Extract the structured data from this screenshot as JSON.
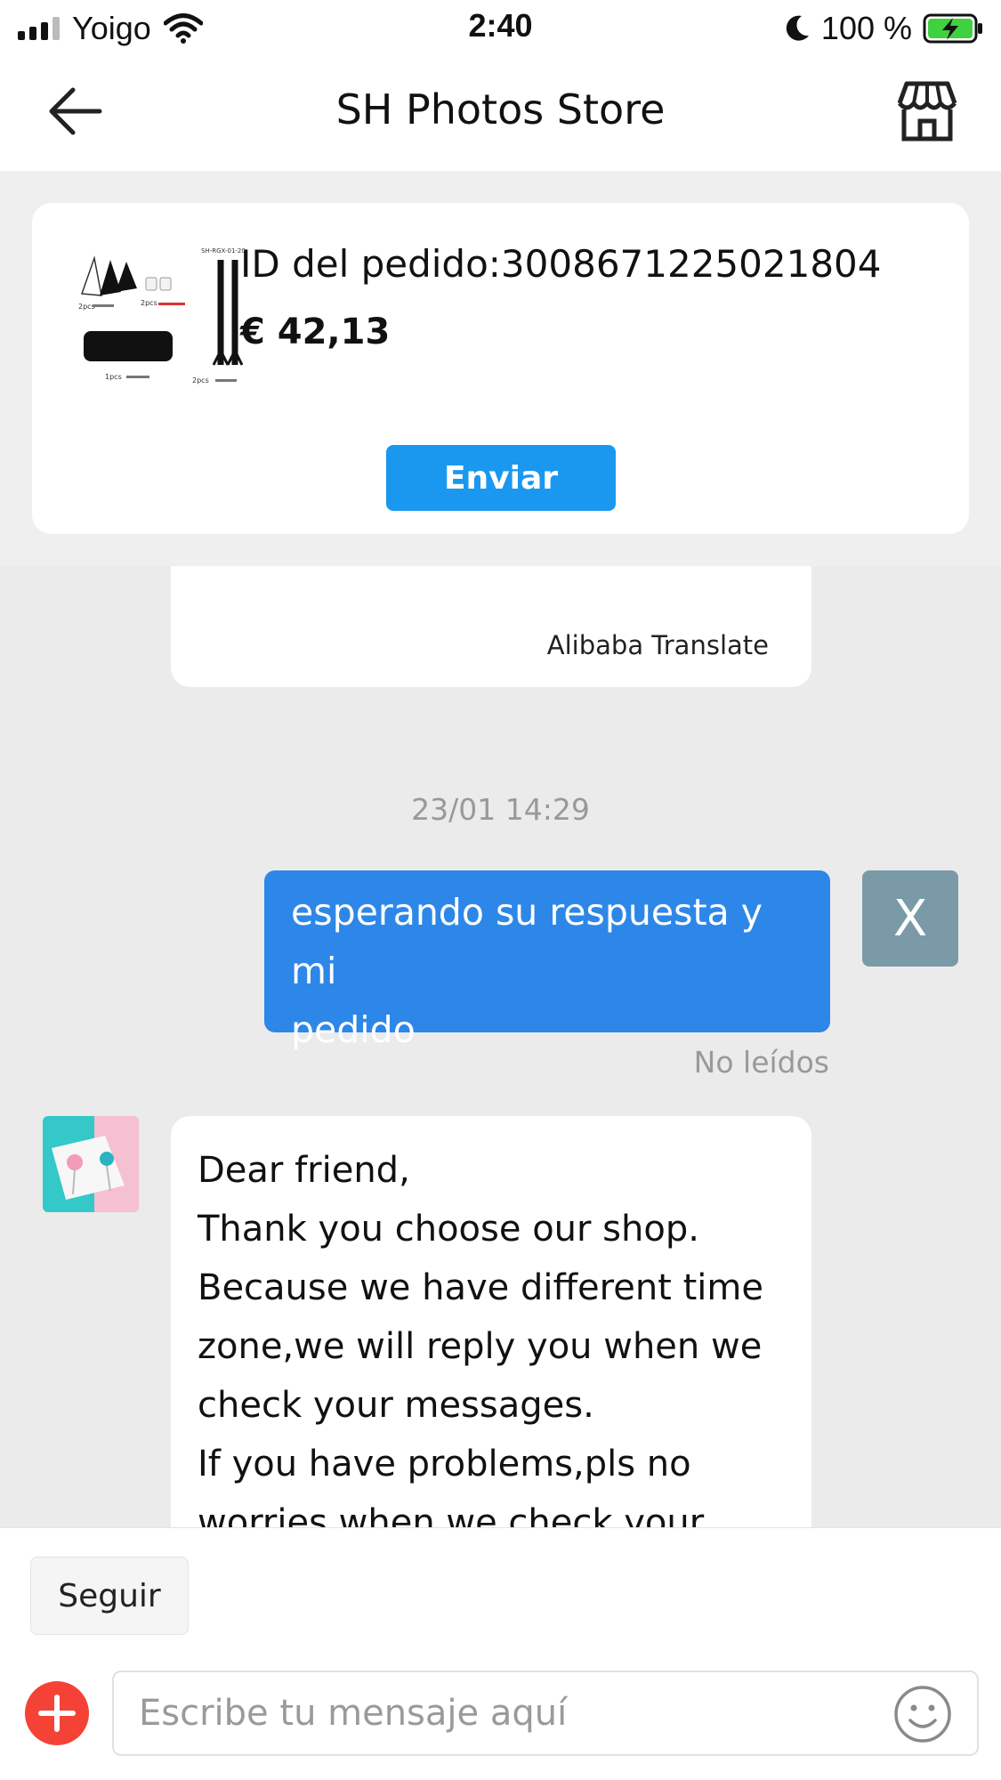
{
  "status_bar": {
    "carrier": "Yoigo",
    "time": "2:40",
    "battery_percent": "100 %"
  },
  "header": {
    "title": "SH Photos Store"
  },
  "order": {
    "id_text": "ID del pedido:3008671225021804",
    "price": "€ 42,13",
    "send_button": "Enviar",
    "thumb_labels": [
      "SH-RGX-01-20",
      "2pcs",
      "2pcs",
      "1pcs",
      "2pcs"
    ]
  },
  "chat": {
    "prev_message_credit": "Alibaba Translate",
    "timestamp": "23/01 14:29",
    "sent_message_lines": [
      "esperando su respuesta y mi",
      "pedido"
    ],
    "retry_button": "X",
    "read_status": "No leídos",
    "received_message_lines": [
      "Dear friend,",
      "Thank you choose our shop.",
      "Because we have different time",
      "zone,we will reply you when we",
      "check your messages.",
      "If you have problems,pls no",
      "worries when we check your"
    ]
  },
  "footer": {
    "follow_button": "Seguir",
    "input_placeholder": "Escribe tu mensaje aquí"
  },
  "colors": {
    "accent_blue": "#1a98f0",
    "sent_bubble": "#2d87e8",
    "plus_red": "#f44336",
    "background": "#ebebeb"
  },
  "icons": {
    "back": "arrow-left-icon",
    "store": "store-icon",
    "plus": "plus-icon",
    "emoji": "smiley-icon",
    "wifi": "wifi-icon",
    "moon": "moon-icon",
    "battery": "battery-charging-icon"
  }
}
